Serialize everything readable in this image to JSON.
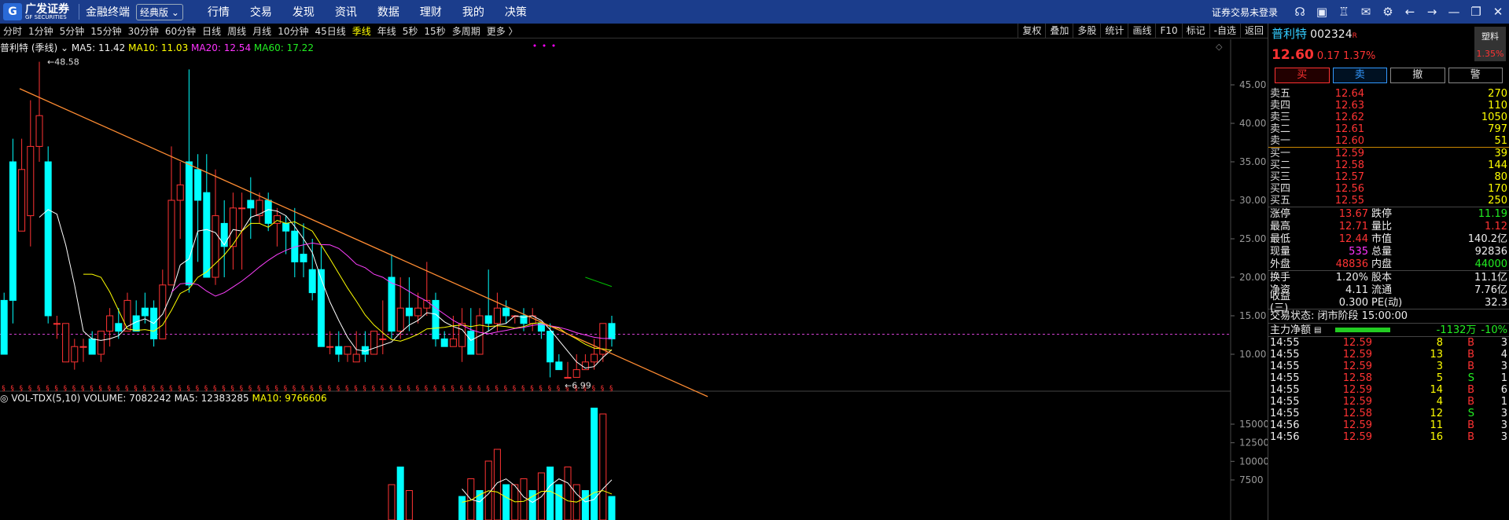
{
  "titlebar": {
    "logo_text": "广发证券",
    "logo_sub": "GF SECURITIES",
    "app_name": "金融终端",
    "edition": "经典版",
    "menu": [
      "行情",
      "交易",
      "发现",
      "资讯",
      "数据",
      "理财",
      "我的",
      "决策"
    ],
    "login_status": "证券交易未登录"
  },
  "periods": [
    "分时",
    "1分钟",
    "5分钟",
    "15分钟",
    "30分钟",
    "60分钟",
    "日线",
    "周线",
    "月线",
    "10分钟",
    "45日线",
    "季线",
    "年线",
    "5秒",
    "15秒",
    "多周期",
    "更多 〉"
  ],
  "active_period": "季线",
  "right_tools": [
    "复权",
    "叠加",
    "多股",
    "统计",
    "画线",
    "F10",
    "标记",
    "-自选",
    "返回"
  ],
  "legend": {
    "name": "普利特 (季线)",
    "ma5": "MA5: 11.42",
    "ma10": "MA10: 11.03",
    "ma20": "MA20: 12.54",
    "ma60": "MA60: 17.22"
  },
  "vol_legend": {
    "name": "VOL-TDX(5,10)",
    "volume": "VOLUME: 7082242",
    "ma5": "MA5: 12383285",
    "ma10": "MA10: 9766606"
  },
  "high_label": "48.58",
  "low_label": "6.99",
  "price_axis": [
    "45.00",
    "40.00",
    "35.00",
    "30.00",
    "25.00",
    "20.00",
    "15.00",
    "10.00"
  ],
  "vol_axis": [
    "15000",
    "12500",
    "10000",
    "7500"
  ],
  "stock": {
    "name": "普利特",
    "code": "002324",
    "r_tag": "R",
    "sector": "塑料",
    "sector_chg": "1.35%",
    "price": "12.60",
    "change": "0.17",
    "pct": "1.37%"
  },
  "trade_buttons": [
    "买",
    "卖",
    "撤",
    "警"
  ],
  "asks": [
    {
      "label": "卖五",
      "price": "12.64",
      "vol": "270"
    },
    {
      "label": "卖四",
      "price": "12.63",
      "vol": "110"
    },
    {
      "label": "卖三",
      "price": "12.62",
      "vol": "1050"
    },
    {
      "label": "卖二",
      "price": "12.61",
      "vol": "797"
    },
    {
      "label": "卖一",
      "price": "12.60",
      "vol": "51"
    }
  ],
  "bids": [
    {
      "label": "买一",
      "price": "12.59",
      "vol": "39"
    },
    {
      "label": "买二",
      "price": "12.58",
      "vol": "144"
    },
    {
      "label": "买三",
      "price": "12.57",
      "vol": "80"
    },
    {
      "label": "买四",
      "price": "12.56",
      "vol": "170"
    },
    {
      "label": "买五",
      "price": "12.55",
      "vol": "250"
    }
  ],
  "stats": [
    {
      "l1": "涨停",
      "v1": "13.67",
      "l2": "跌停",
      "v2": "11.19"
    },
    {
      "l1": "最高",
      "v1": "12.71",
      "l2": "量比",
      "v2": "1.12"
    },
    {
      "l1": "最低",
      "v1": "12.44",
      "l2": "市值",
      "v2": "140.2亿"
    },
    {
      "l1": "现量",
      "v1": "535",
      "l2": "总量",
      "v2": "92836"
    },
    {
      "l1": "外盘",
      "v1": "48836",
      "l2": "内盘",
      "v2": "44000"
    }
  ],
  "stats2": [
    {
      "l1": "换手",
      "v1": "1.20%",
      "l2": "股本",
      "v2": "11.1亿"
    },
    {
      "l1": "净资",
      "v1": "4.11",
      "l2": "流通",
      "v2": "7.76亿"
    },
    {
      "l1": "收益(三)",
      "v1": "0.300",
      "l2": "PE(动)",
      "v2": "32.3"
    }
  ],
  "trade_status": "交易状态: 闭市阶段 15:00:00",
  "main_flow": {
    "label": "主力净额",
    "value": "-1132万",
    "pct": "-10%"
  },
  "ticks": [
    {
      "t": "14:55",
      "p": "12.59",
      "v": "8",
      "d": "B",
      "n": "3"
    },
    {
      "t": "14:55",
      "p": "12.59",
      "v": "13",
      "d": "B",
      "n": "4"
    },
    {
      "t": "14:55",
      "p": "12.59",
      "v": "3",
      "d": "B",
      "n": "3"
    },
    {
      "t": "14:55",
      "p": "12.58",
      "v": "5",
      "d": "S",
      "n": "1"
    },
    {
      "t": "14:55",
      "p": "12.59",
      "v": "14",
      "d": "B",
      "n": "6"
    },
    {
      "t": "14:55",
      "p": "12.59",
      "v": "4",
      "d": "B",
      "n": "1"
    },
    {
      "t": "14:55",
      "p": "12.58",
      "v": "12",
      "d": "S",
      "n": "3"
    },
    {
      "t": "14:56",
      "p": "12.59",
      "v": "11",
      "d": "B",
      "n": "3"
    },
    {
      "t": "14:56",
      "p": "12.59",
      "v": "16",
      "d": "B",
      "n": "3"
    }
  ],
  "candles": [
    [
      11,
      17,
      10,
      18,
      10
    ],
    [
      12,
      35,
      17,
      38,
      14
    ],
    [
      13,
      26,
      34,
      38,
      26
    ],
    [
      14,
      28,
      37,
      43,
      24
    ],
    [
      15,
      37,
      41,
      48,
      35
    ],
    [
      16,
      35,
      15,
      37,
      14
    ],
    [
      17,
      14,
      14,
      15,
      12
    ],
    [
      18,
      9,
      14,
      14,
      9
    ],
    [
      19,
      9,
      11,
      12,
      8
    ],
    [
      20,
      11,
      11,
      12,
      9
    ],
    [
      21,
      12,
      10,
      13,
      10
    ],
    [
      22,
      10,
      13,
      13,
      9
    ],
    [
      23,
      13,
      15,
      16,
      11
    ],
    [
      24,
      14,
      13,
      16,
      12
    ],
    [
      25,
      13,
      17,
      18,
      13
    ],
    [
      26,
      15,
      13,
      17,
      13
    ],
    [
      27,
      16,
      15,
      18,
      14
    ],
    [
      28,
      16,
      12,
      17,
      11
    ],
    [
      29,
      12,
      19,
      21,
      12
    ],
    [
      30,
      19,
      30,
      37,
      19
    ],
    [
      31,
      30,
      32,
      35,
      25
    ],
    [
      32,
      35,
      19,
      47,
      18
    ],
    [
      33,
      34,
      30,
      36,
      22
    ],
    [
      34,
      31,
      20,
      36,
      20
    ],
    [
      35,
      20,
      28,
      34,
      19
    ],
    [
      36,
      27,
      24,
      30,
      20
    ],
    [
      37,
      24,
      29,
      31,
      21
    ],
    [
      38,
      29,
      29,
      31,
      21
    ],
    [
      39,
      30,
      29,
      33,
      25
    ],
    [
      40,
      28,
      30,
      31,
      27
    ],
    [
      41,
      30,
      27,
      31,
      26
    ],
    [
      42,
      27,
      28,
      29,
      24
    ],
    [
      43,
      27,
      26,
      28,
      23
    ],
    [
      44,
      26,
      22,
      29,
      20
    ],
    [
      45,
      23,
      22,
      27,
      20
    ],
    [
      46,
      21,
      18,
      25,
      17
    ],
    [
      47,
      21,
      11,
      24,
      11
    ],
    [
      48,
      11,
      11,
      13,
      10
    ],
    [
      49,
      11,
      10,
      13,
      9
    ],
    [
      50,
      10,
      11,
      11,
      9
    ],
    [
      51,
      9,
      10,
      13,
      10
    ],
    [
      52,
      11,
      10,
      13,
      9
    ],
    [
      53,
      10,
      13,
      13,
      11
    ],
    [
      54,
      12,
      12,
      17,
      10
    ],
    [
      55,
      20,
      13,
      23,
      12
    ],
    [
      56,
      13,
      16,
      20,
      12
    ],
    [
      57,
      16,
      15,
      20,
      13
    ],
    [
      58,
      15,
      16,
      18,
      14
    ],
    [
      59,
      16,
      17,
      22,
      15
    ],
    [
      60,
      17,
      12,
      18,
      11
    ],
    [
      61,
      12,
      11,
      13,
      11
    ],
    [
      62,
      11,
      12,
      15,
      11
    ],
    [
      63,
      11,
      14,
      16,
      9
    ],
    [
      64,
      13,
      10,
      16,
      10
    ],
    [
      65,
      10,
      15,
      16,
      10
    ],
    [
      66,
      15,
      14,
      21,
      13
    ],
    [
      67,
      14,
      16,
      18,
      13
    ],
    [
      68,
      16,
      15,
      17,
      14
    ],
    [
      69,
      15,
      15,
      15,
      14
    ],
    [
      70,
      15,
      14,
      16,
      13
    ],
    [
      71,
      14,
      15,
      16,
      13
    ],
    [
      72,
      14,
      13,
      14,
      12
    ],
    [
      73,
      13,
      9,
      14,
      7
    ],
    [
      74,
      9,
      8,
      10,
      8
    ],
    [
      75,
      7,
      7,
      9,
      7
    ],
    [
      76,
      7,
      8,
      10,
      7
    ],
    [
      77,
      8,
      9,
      10,
      8
    ],
    [
      78,
      9,
      10,
      12,
      8
    ],
    [
      79,
      10,
      14,
      14,
      9
    ],
    [
      80,
      14,
      12,
      15,
      11
    ]
  ],
  "ma_lines": {
    "ma5": "white",
    "ma10": "yellow",
    "ma20": "magenta",
    "ma60": "#00c000"
  },
  "volumes": [
    [
      55,
      0.3,
      1
    ],
    [
      56,
      0.45,
      0
    ],
    [
      57,
      0.25,
      1
    ],
    [
      63,
      0.2,
      0
    ],
    [
      64,
      0.35,
      1
    ],
    [
      65,
      0.25,
      0
    ],
    [
      66,
      0.5,
      1
    ],
    [
      67,
      0.6,
      1
    ],
    [
      68,
      0.3,
      0
    ],
    [
      69,
      0.3,
      1
    ],
    [
      70,
      0.35,
      1
    ],
    [
      71,
      0.25,
      0
    ],
    [
      72,
      0.4,
      1
    ],
    [
      73,
      0.45,
      0
    ],
    [
      74,
      0.3,
      0
    ],
    [
      75,
      0.45,
      1
    ],
    [
      76,
      0.3,
      1
    ],
    [
      77,
      0.25,
      0
    ],
    [
      78,
      0.95,
      0
    ],
    [
      79,
      0.9,
      1
    ],
    [
      80,
      0.2,
      0
    ]
  ]
}
